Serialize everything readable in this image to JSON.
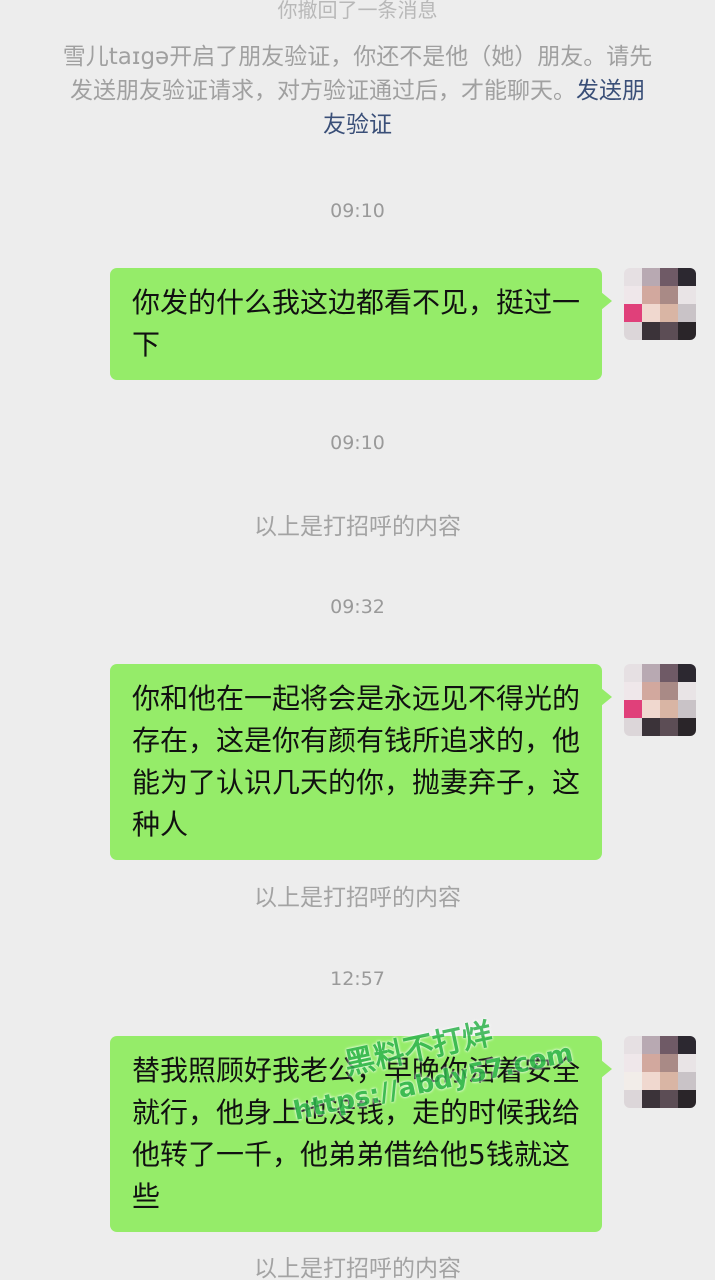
{
  "header": {
    "top_cutoff_text": "你撤回了一条消息"
  },
  "notice": {
    "text": "雪儿taɪgə开启了朋友验证，你还不是他（她）朋友。请先发送朋友验证请求，对方验证通过后，才能聊天。",
    "link": "发送朋友验证"
  },
  "chat": {
    "time_1": "09:10",
    "message_1": "你发的什么我这边都看不见，挺过一下",
    "time_2": "09:10",
    "system_1": "以上是打招呼的内容",
    "time_3": "09:32",
    "message_2": "你和他在一起将会是永远见不得光的存在，这是你有颜有钱所追求的，他能为了认识几天的你，抛妻弃子，这种人",
    "system_2": "以上是打招呼的内容",
    "time_4": "12:57",
    "message_3": "替我照顾好我老公，早晚你活着安全就行，他身上也没钱，走的时候我给他转了一千，他弟弟借给他5钱就这些",
    "system_3": "以上是打招呼的内容"
  },
  "watermark": {
    "line1": "黑料不打烊",
    "line2": "https://abdy57.com"
  },
  "colors": {
    "bubble_green": "#95ec69",
    "background": "#ededed",
    "link": "#3a4f78"
  }
}
